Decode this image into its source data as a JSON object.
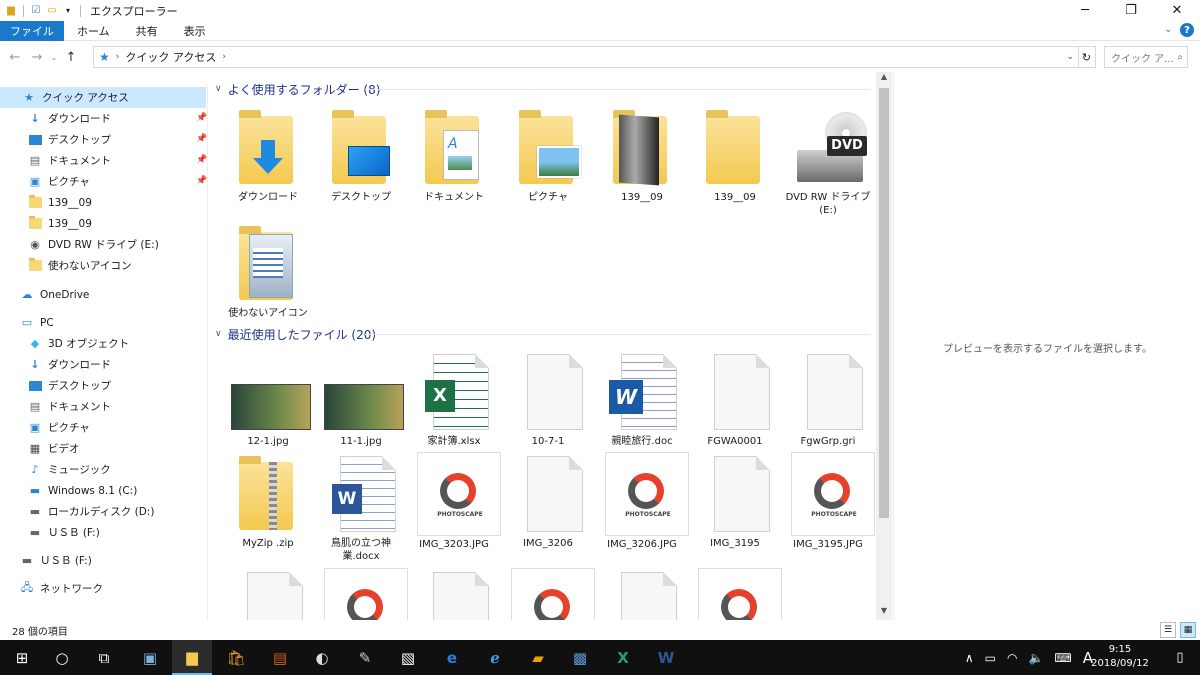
{
  "window": {
    "title": "エクスプローラー"
  },
  "ribbon": {
    "tabs": [
      "ファイル",
      "ホーム",
      "共有",
      "表示"
    ]
  },
  "address": {
    "segments": [
      "クイック アクセス"
    ],
    "search_placeholder": "クイック ア..."
  },
  "nav": {
    "quick_access": "クイック アクセス",
    "qa_items": [
      "ダウンロード",
      "デスクトップ",
      "ドキュメント",
      "ピクチャ",
      "139__09",
      "139__09",
      "DVD RW ドライブ (E:)",
      "使わないアイコン"
    ],
    "onedrive": "OneDrive",
    "pc": "PC",
    "pc_items": [
      "3D オブジェクト",
      "ダウンロード",
      "デスクトップ",
      "ドキュメント",
      "ピクチャ",
      "ビデオ",
      "ミュージック",
      "Windows 8.1 (C:)",
      "ローカルディスク (D:)",
      "ＵＳＢ (F:)"
    ],
    "usb": "ＵＳＢ (F:)",
    "network": "ネットワーク"
  },
  "groups": {
    "frequent": "よく使用するフォルダー (8)",
    "recent": "最近使用したファイル (20)"
  },
  "frequent_folders": [
    "ダウンロード",
    "デスクトップ",
    "ドキュメント",
    "ピクチャ",
    "139__09",
    "139__09",
    "DVD RW ドライブ (E:)",
    "使わないアイコン"
  ],
  "recent_files": [
    "12-1.jpg",
    "11-1.jpg",
    "家計簿.xlsx",
    "10-7-1",
    "親睦旅行.doc",
    "FGWA0001",
    "FgwGrp.gri",
    "MyZip .zip",
    "鳥肌の立つ神業.docx",
    "IMG_3203.JPG",
    "IMG_3206",
    "IMG_3206.JPG",
    "IMG_3195",
    "IMG_3195.JPG"
  ],
  "photoscape_text": "PHOTOSCAPE",
  "dvd_text": "DVD",
  "preview": {
    "message": "プレビューを表示するファイルを選択します。"
  },
  "status": {
    "items": "28 個の項目"
  },
  "taskbar": {
    "time": "9:15",
    "date": "2018/09/12",
    "ime": "A"
  },
  "colors": {
    "accent": "#1979ca",
    "selection": "#cce8ff",
    "folder": "#f3c94f"
  }
}
